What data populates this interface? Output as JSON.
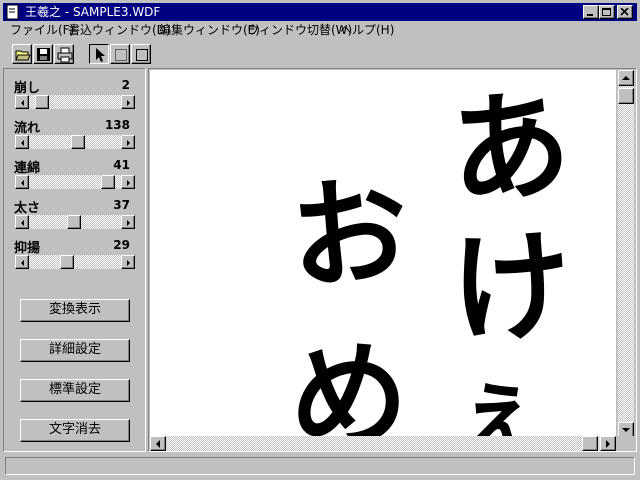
{
  "window": {
    "title": "王羲之 - SAMPLE3.WDF"
  },
  "menu": [
    "ファイル(F)",
    "書込ウィンドウ(D)",
    "編集ウィンドウ(E)",
    "ウィンドウ切替(W)",
    "ヘルプ(H)"
  ],
  "toolbar": {
    "icons": [
      "open-icon",
      "save-icon",
      "print-icon",
      "pointer-icon",
      "select-rect-icon",
      "rectangle-icon"
    ]
  },
  "sliders": [
    {
      "label": "崩し",
      "value": "2",
      "fraction": 0.08
    },
    {
      "label": "流れ",
      "value": "138",
      "fraction": 0.54
    },
    {
      "label": "連綿",
      "value": "41",
      "fraction": 0.92
    },
    {
      "label": "太さ",
      "value": "37",
      "fraction": 0.49
    },
    {
      "label": "抑揚",
      "value": "29",
      "fraction": 0.4
    }
  ],
  "buttons": {
    "convert": "変換表示",
    "detail": "詳細設定",
    "standard": "標準設定",
    "erase": "文字消去"
  },
  "calligraphy": [
    "あ",
    "け",
    "ぇ",
    "お",
    "め"
  ],
  "colors": {
    "titlebar": "#000080",
    "face": "#c0c0c0",
    "ink": "#000000"
  }
}
